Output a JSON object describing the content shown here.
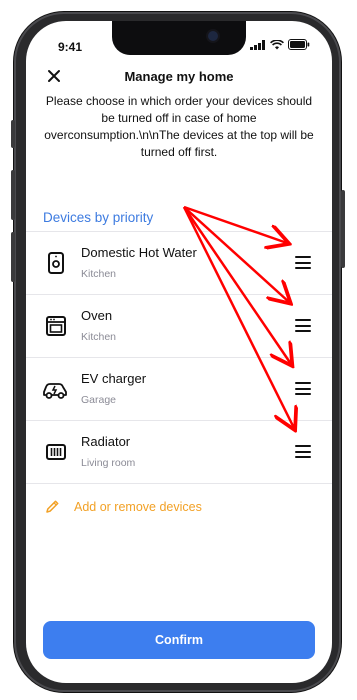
{
  "status_bar": {
    "time": "9:41"
  },
  "header": {
    "title": "Manage my home",
    "close_icon": "close-icon"
  },
  "description": "Please choose in which order your devices should be turned off in case of home overconsumption.\\n\\nThe devices at the top will be turned off first.",
  "section": {
    "title": "Devices by priority"
  },
  "devices": [
    {
      "name": "Domestic Hot Water",
      "room": "Kitchen",
      "icon": "water-heater-icon"
    },
    {
      "name": "Oven",
      "room": "Kitchen",
      "icon": "oven-icon"
    },
    {
      "name": "EV charger",
      "room": "Garage",
      "icon": "ev-car-icon"
    },
    {
      "name": "Radiator",
      "room": "Living room",
      "icon": "radiator-icon"
    }
  ],
  "add_devices": {
    "label": "Add or remove devices",
    "icon": "pencil-icon"
  },
  "confirm": {
    "label": "Confirm"
  },
  "colors": {
    "accent_blue": "#3d7be0",
    "button_blue": "#3d7eef",
    "add_orange": "#f2a126",
    "annotation_red": "#ff0000"
  }
}
